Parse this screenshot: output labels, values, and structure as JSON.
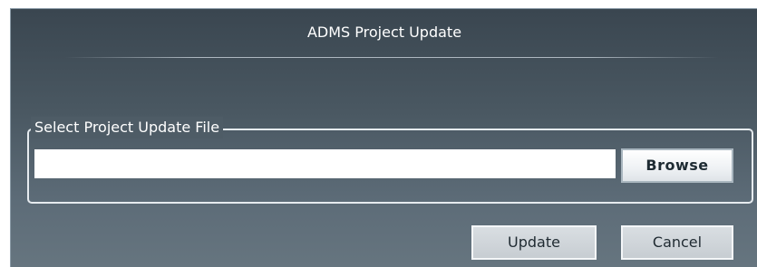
{
  "dialog": {
    "title": "ADMS Project Update",
    "file_group": {
      "legend": "Select Project Update File",
      "path_value": "",
      "browse_label": "Browse"
    },
    "update_label": "Update",
    "cancel_label": "Cancel"
  },
  "colors": {
    "panel_top": "#3a4650",
    "panel_bottom": "#66757f",
    "button_face": "#c7cdd2",
    "text_light": "#ffffff"
  }
}
